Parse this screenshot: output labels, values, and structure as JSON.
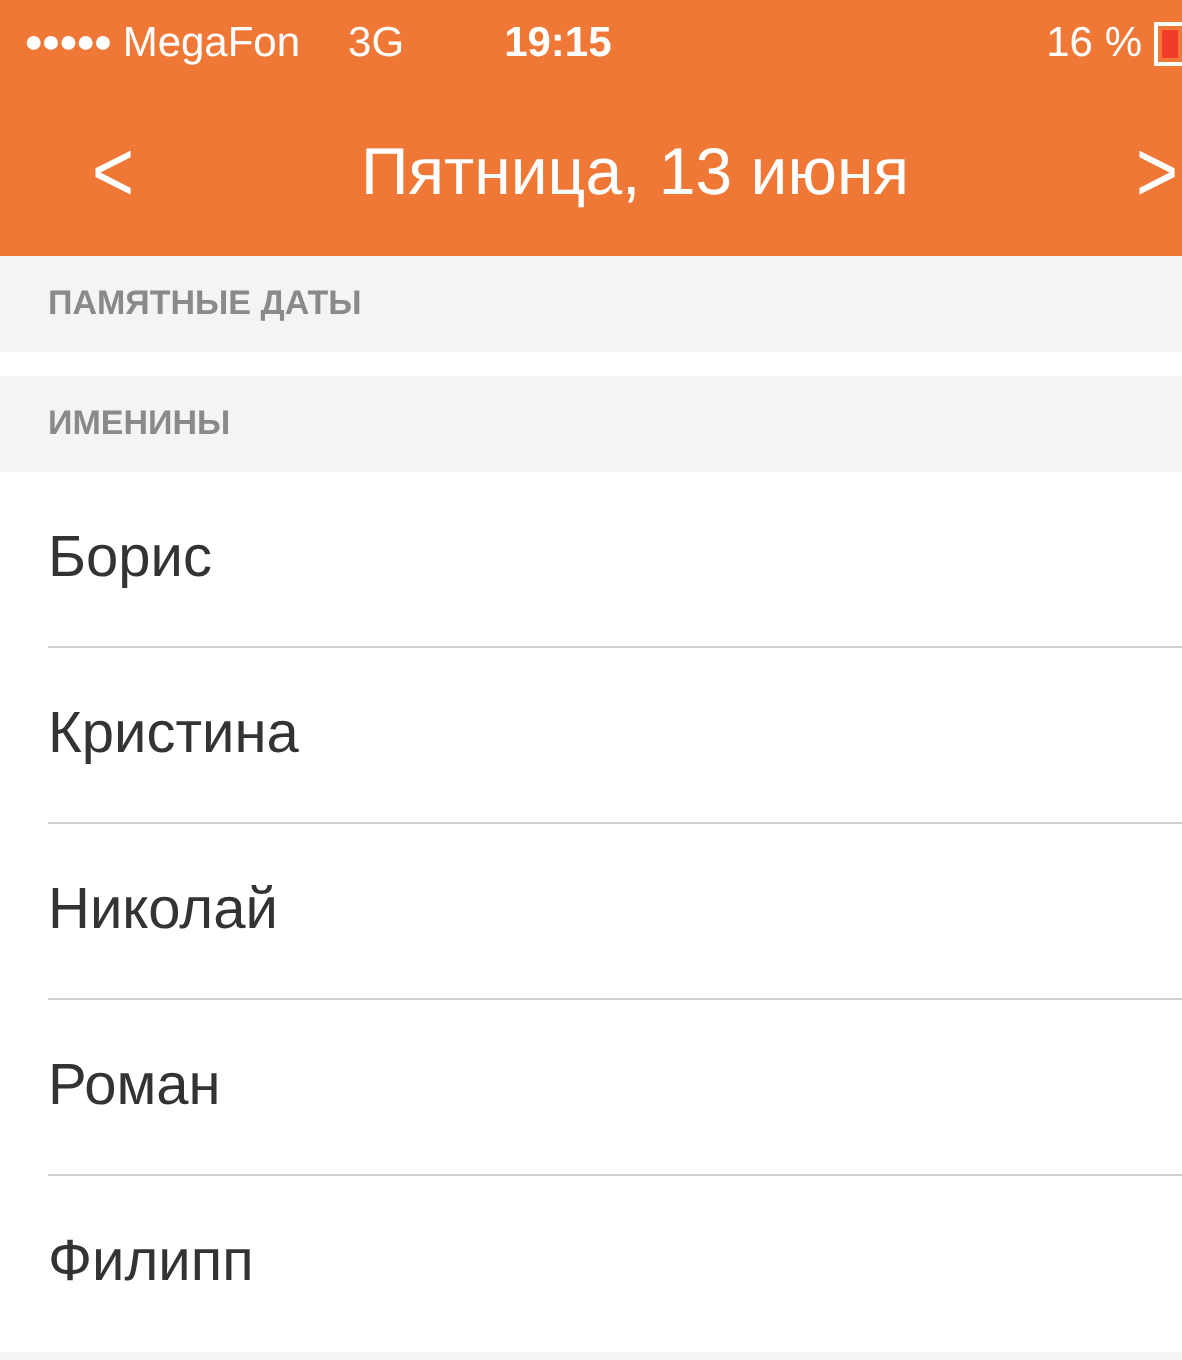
{
  "status_bar": {
    "signal_dots": "●●●●●",
    "carrier": "MegaFon",
    "network": "3G",
    "time": "19:15",
    "battery": "16 %"
  },
  "nav": {
    "back": "<",
    "title": "Пятница, 13 июня",
    "forward": ">"
  },
  "sections": [
    {
      "header": "ПАМЯТНЫЕ ДАТЫ"
    },
    {
      "header": "ИМЕНИНЫ",
      "items": [
        "Борис",
        "Кристина",
        "Николай",
        "Роман",
        "Филипп"
      ]
    }
  ]
}
